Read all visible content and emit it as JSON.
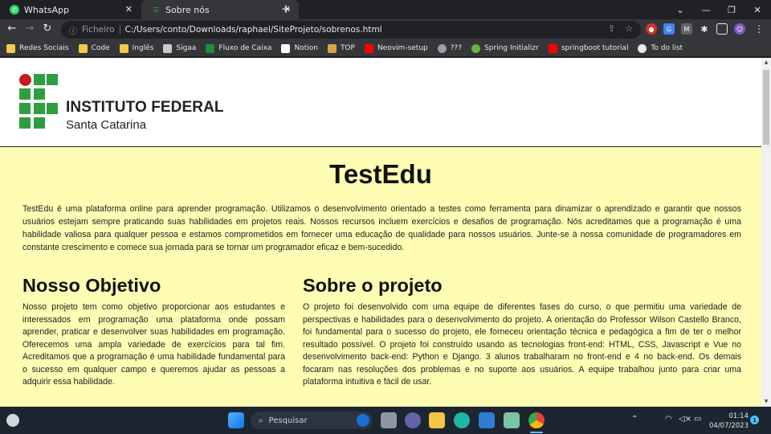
{
  "browser": {
    "tabs": [
      {
        "title": "WhatsApp",
        "active": false
      },
      {
        "title": "Sobre nós",
        "active": true
      }
    ],
    "new_tab": "+",
    "address": {
      "scheme_label": "Ficheiro",
      "url": "C:/Users/conto/Downloads/raphael/SiteProjeto/sobrenos.html"
    },
    "bookmarks": [
      {
        "label": "Redes Sociais",
        "icon": "folder-icon",
        "color": "#f2c94c"
      },
      {
        "label": "Code",
        "icon": "folder-icon",
        "color": "#f2c94c"
      },
      {
        "label": "Inglês",
        "icon": "folder-icon",
        "color": "#f2c94c"
      },
      {
        "label": "Sigaa",
        "icon": "sigaa-icon",
        "color": "#c9c9c9"
      },
      {
        "label": "Fluxo de Caixa",
        "icon": "sheets-icon",
        "color": "#1e8e3e"
      },
      {
        "label": "Notion",
        "icon": "notion-icon",
        "color": "#ffffff"
      },
      {
        "label": "TOP",
        "icon": "trophy-icon",
        "color": "#d9a441"
      },
      {
        "label": "Neovim-setup",
        "icon": "youtube-icon",
        "color": "#ff0000"
      },
      {
        "label": "???",
        "icon": "globe-icon",
        "color": "#9aa0a6"
      },
      {
        "label": "Spring Initializr",
        "icon": "spring-icon",
        "color": "#6db33f"
      },
      {
        "label": "springboot tutorial",
        "icon": "youtube-icon",
        "color": "#ff0000"
      },
      {
        "label": "To do list",
        "icon": "globe-icon",
        "color": "#e8eaed"
      }
    ]
  },
  "site": {
    "logo_name": "INSTITUTO FEDERAL",
    "logo_campus": "Santa Catarina",
    "title": "TestEdu",
    "intro": "TestEdu é uma plataforma online para aprender programação. Utilizamos o desenvolvimento orientado a testes como ferramenta para dinamizar o aprendizado e garantir que nossos usuários estejam sempre praticando suas habilidades em projetos reais. Nossos recursos incluem exercícios e desafios de programação. Nós acreditamos que a programação é uma habilidade valiosa para qualquer pessoa e estamos comprometidos em fornecer uma educação de qualidade para nossos usuários. Junte-se à nossa comunidade de programadores em constante crescimento e comece sua jornada para se tornar um programador eficaz e bem-sucedido.",
    "objective_title": "Nosso Objetivo",
    "objective_text": "Nosso projeto tem como objetivo proporcionar aos estudantes e interessados em programação uma plataforma onde possam aprender, praticar e desenvolver suas habilidades em programação. Oferecemos uma ampla variedade de exercícios para tal fim. Acreditamos que a programação é uma habilidade fundamental para o sucesso em qualquer campo e queremos ajudar as pessoas a adquirir essa habilidade.",
    "project_title": "Sobre o projeto",
    "project_text": "O projeto foi desenvolvido com uma equipe de diferentes fases do curso, o que permitiu uma variedade de perspectivas e habilidades para o desenvolvimento do projeto. A orientação do Professor Wilson Castello Branco, foi fundamental para o sucesso do projeto, ele forneceu orientação técnica e pedagógica a fim de ter o melhor resultado possível. O projeto foi construído usando as tecnologias front-end: HTML, CSS, Javascript e Vue no desenvolvimento back-end: Python e Django. 3 alunos trabalharam no front-end e 4 no back-end. Os demais focaram nas resoluções dos problemas e no suporte aos usuários. A equipe trabalhou junto para criar uma plataforma intuitiva e fácil de usar."
  },
  "taskbar": {
    "search_placeholder": "Pesquisar",
    "time": "01:14",
    "date": "04/07/2023",
    "notifications": "1"
  },
  "colors": {
    "page_bg": "#fffdb3",
    "ifsc_green": "#2f9e41",
    "ifsc_red": "#c8191e"
  }
}
